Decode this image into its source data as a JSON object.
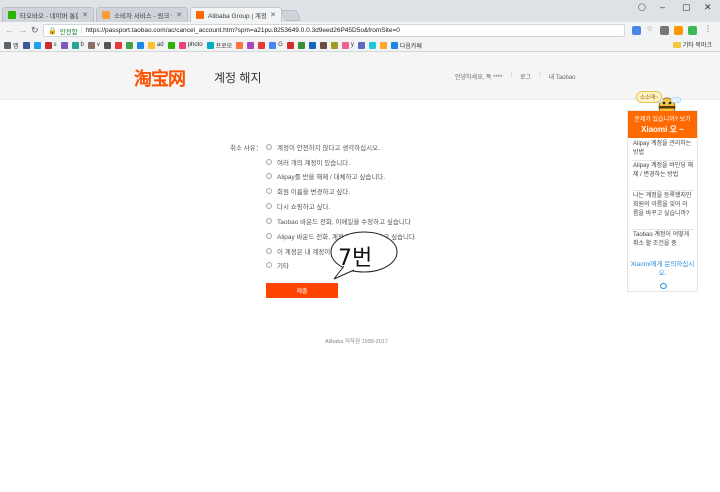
{
  "browser": {
    "tabs": [
      {
        "title": "타오바오 - 네이버 통합",
        "favicon_color": "#2db400"
      },
      {
        "title": "소비자 서비스 - 링크 어",
        "favicon_color": "#ff9a3c"
      },
      {
        "title": "Alibaba Group | 계정 관",
        "favicon_color": "#ff6a00"
      }
    ],
    "window_controls": [
      "‒",
      "▢",
      "✕"
    ],
    "security_label": "안전함",
    "url": "https://passport.taobao.com/ac/cancel_account.htm?spm=a21pu.8253649.0.0.3d9eed26P45D5o&fromSite=0",
    "bookmarks": [
      "앱",
      "s",
      "b",
      "v",
      "ad",
      "photo",
      "프로모",
      "G",
      "y",
      "다음카페"
    ],
    "bookmarks_right": "기타 북마크"
  },
  "header": {
    "logo": "淘宝网",
    "title": "계정 해지",
    "greeting": "안녕하세요, 폭 ****",
    "logout": "로그",
    "my_taobao": "내 Taobao"
  },
  "form": {
    "label": "취소 사유：",
    "options": [
      "계정이 안전하지 않다고 생각하십시오.",
      "여러 개의 계정이 있습니다.",
      "Alipay를 반을 해제 / 대체하고 싶습니다.",
      "회원 이름을 변경하고 싶다.",
      "다시 쇼핑하고 싶다.",
      "Taobao 바운드 전화, 이메일을 수정하고 싶습니다",
      "Alipay 바운드 전화, 계정 정보를 수정하고 싶습니다.",
      "이 계정은 내 계정이 아닙니다.",
      "기타"
    ],
    "submit_label": "제출"
  },
  "annotation": "7번",
  "footer": "Alibaba 저작권 1999-2017",
  "side_panel": {
    "mascot_tag": "소소매~",
    "question": "문제가 있습니까? 보기",
    "brand": "Xiaomi 오 ~",
    "items": [
      "Alipay 계정을 관리하는 방법",
      "Alipay 계정을 바인딩 해제 / 변경하는 방법",
      "나는 계정을 등록했지만 회원의 이름을 잊어 이름을 바꾸고 싶습니까?",
      "Taobao 계정이 어떻게 취소 할 조건을 충"
    ],
    "contact": "Xiaomi에게 문의하십시오."
  },
  "colors": {
    "accent": "#ff5000",
    "button": "#ff4400",
    "panel_header": "#ff6a00",
    "link": "#2a8fd8"
  }
}
